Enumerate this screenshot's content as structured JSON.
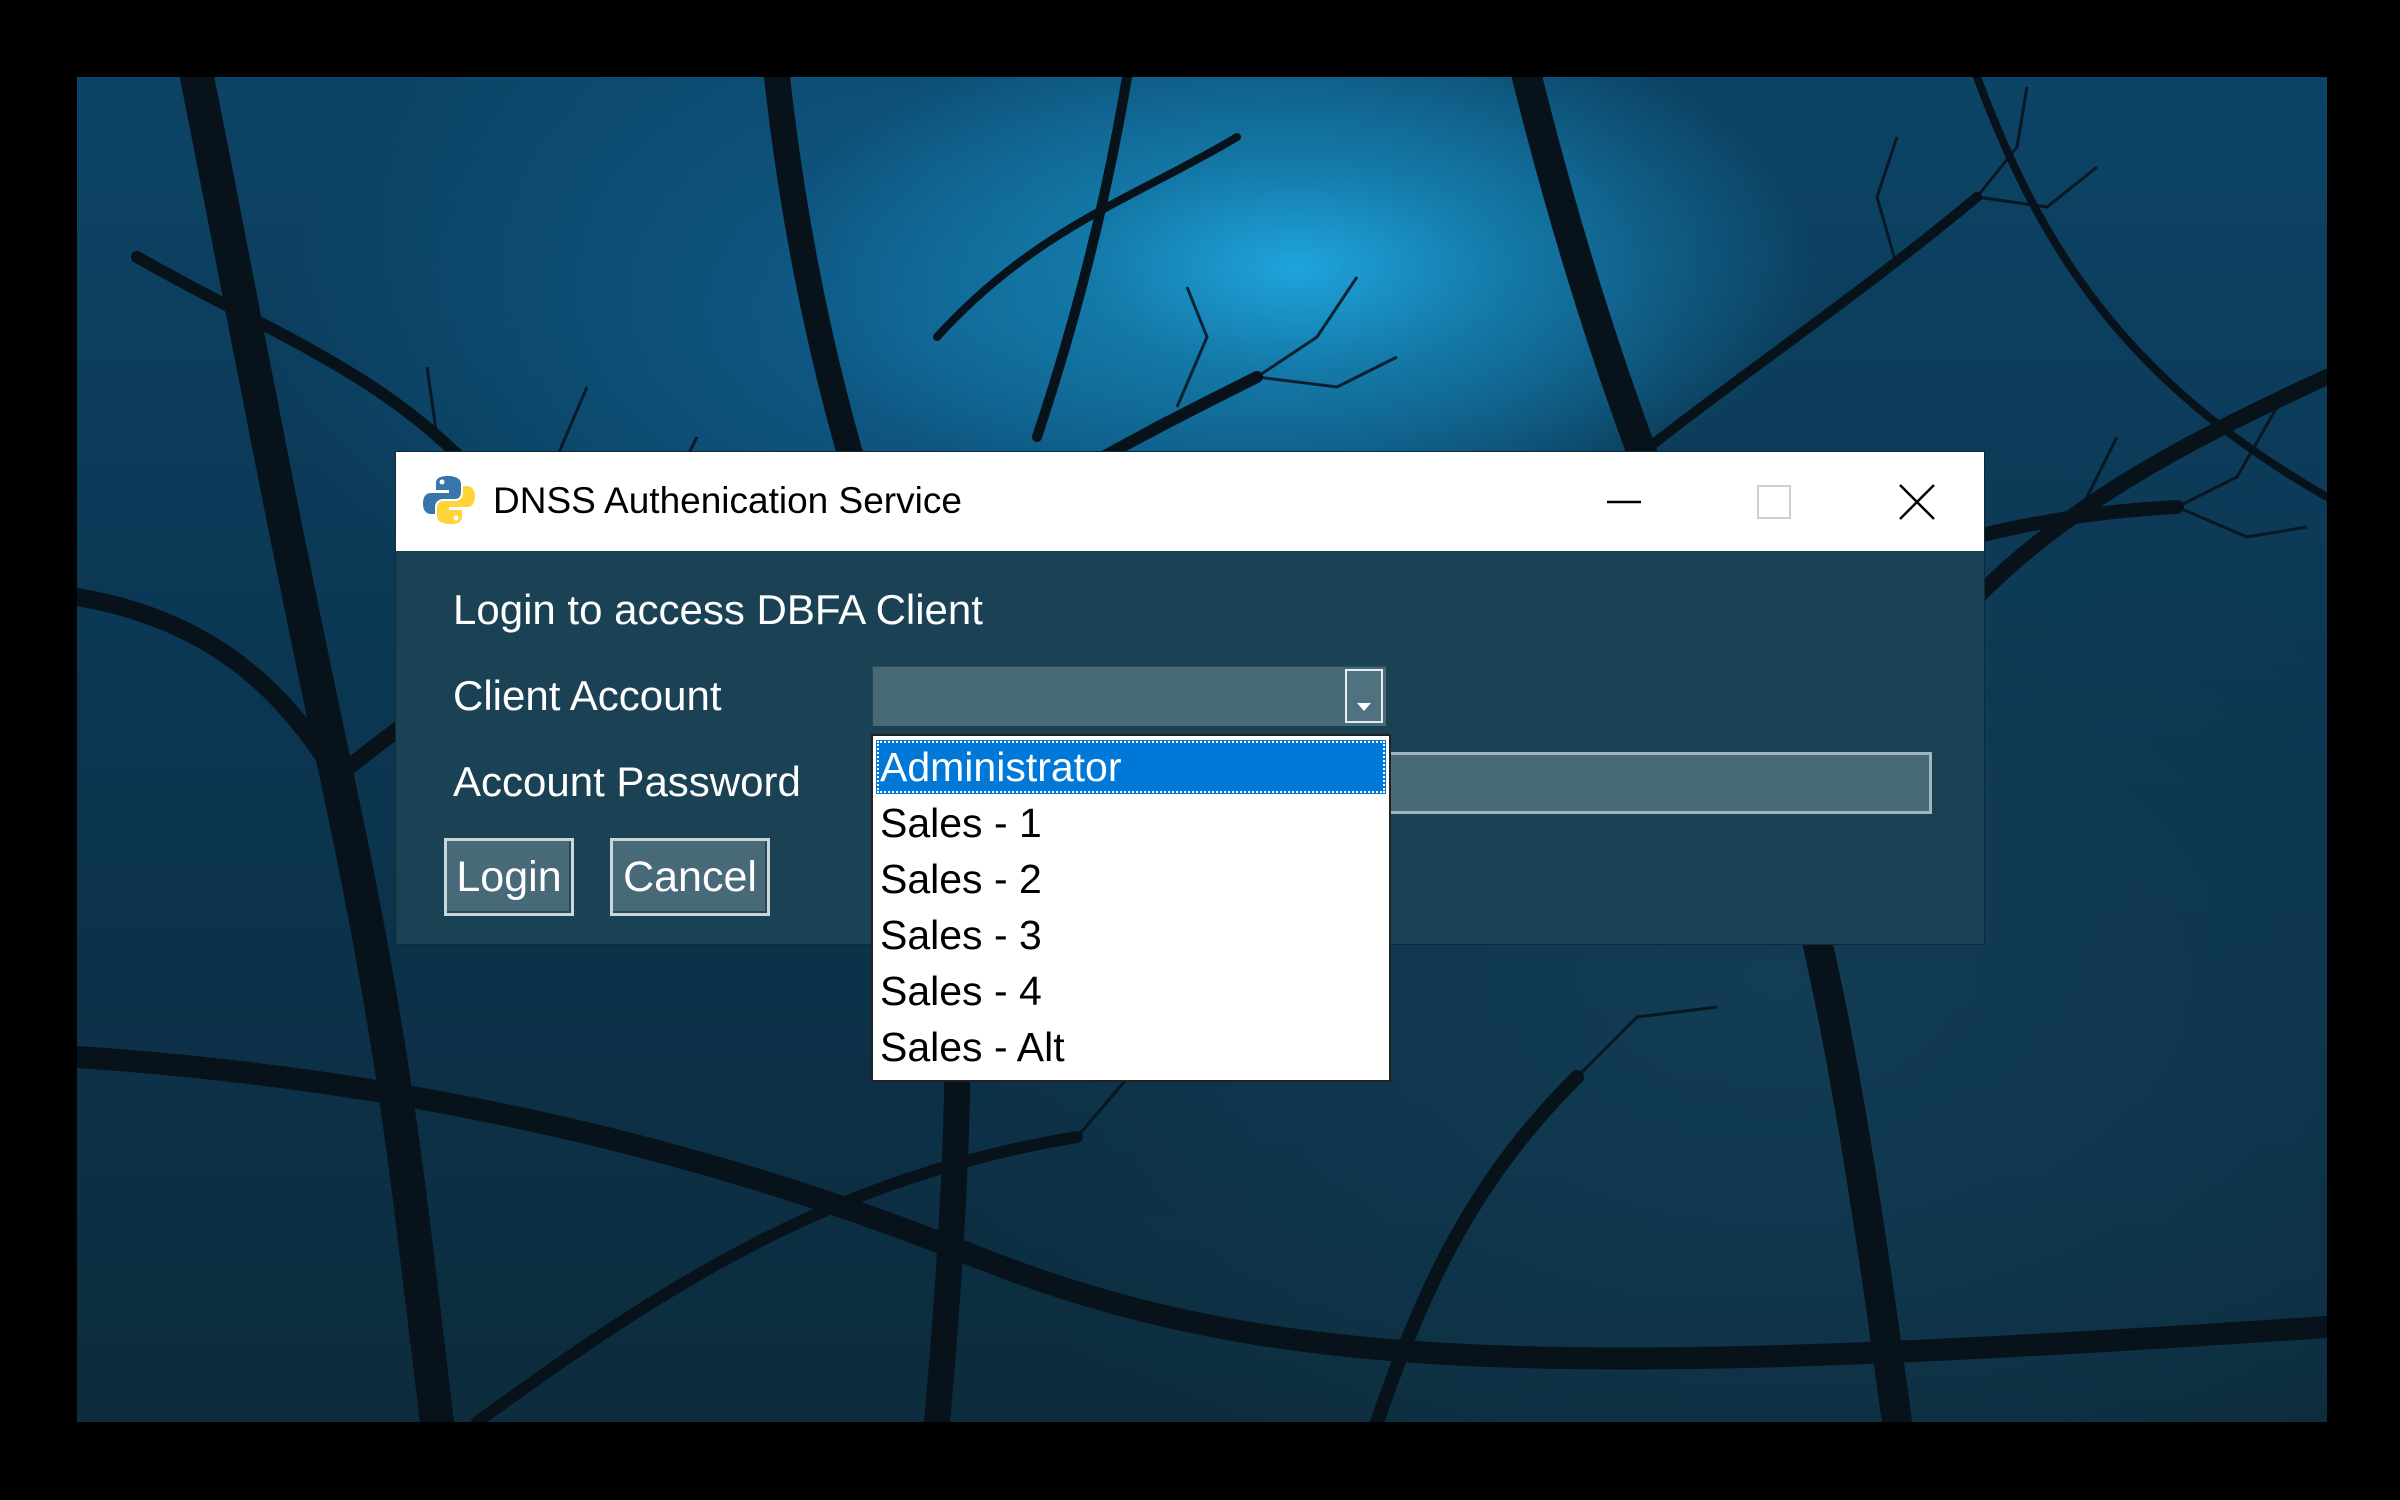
{
  "window": {
    "title": "DNSS Authenication Service",
    "app_icon": "python-icon"
  },
  "titlebar_buttons": {
    "minimize": "minimize-icon",
    "maximize": "maximize-icon",
    "close": "close-icon"
  },
  "form": {
    "heading": "Login to access DBFA Client",
    "client_account_label": "Client Account",
    "client_account_value": "",
    "account_password_label": "Account Password",
    "account_password_value": ""
  },
  "buttons": {
    "login": "Login",
    "cancel": "Cancel"
  },
  "dropdown": {
    "options": [
      "Administrator",
      "Sales - 1",
      "Sales - 2",
      "Sales - 3",
      "Sales - 4",
      "Sales - Alt"
    ],
    "highlighted": "Administrator"
  },
  "colors": {
    "dialog_bg": "#1a4254",
    "field_bg": "#486a78",
    "selection": "#0078d7"
  }
}
